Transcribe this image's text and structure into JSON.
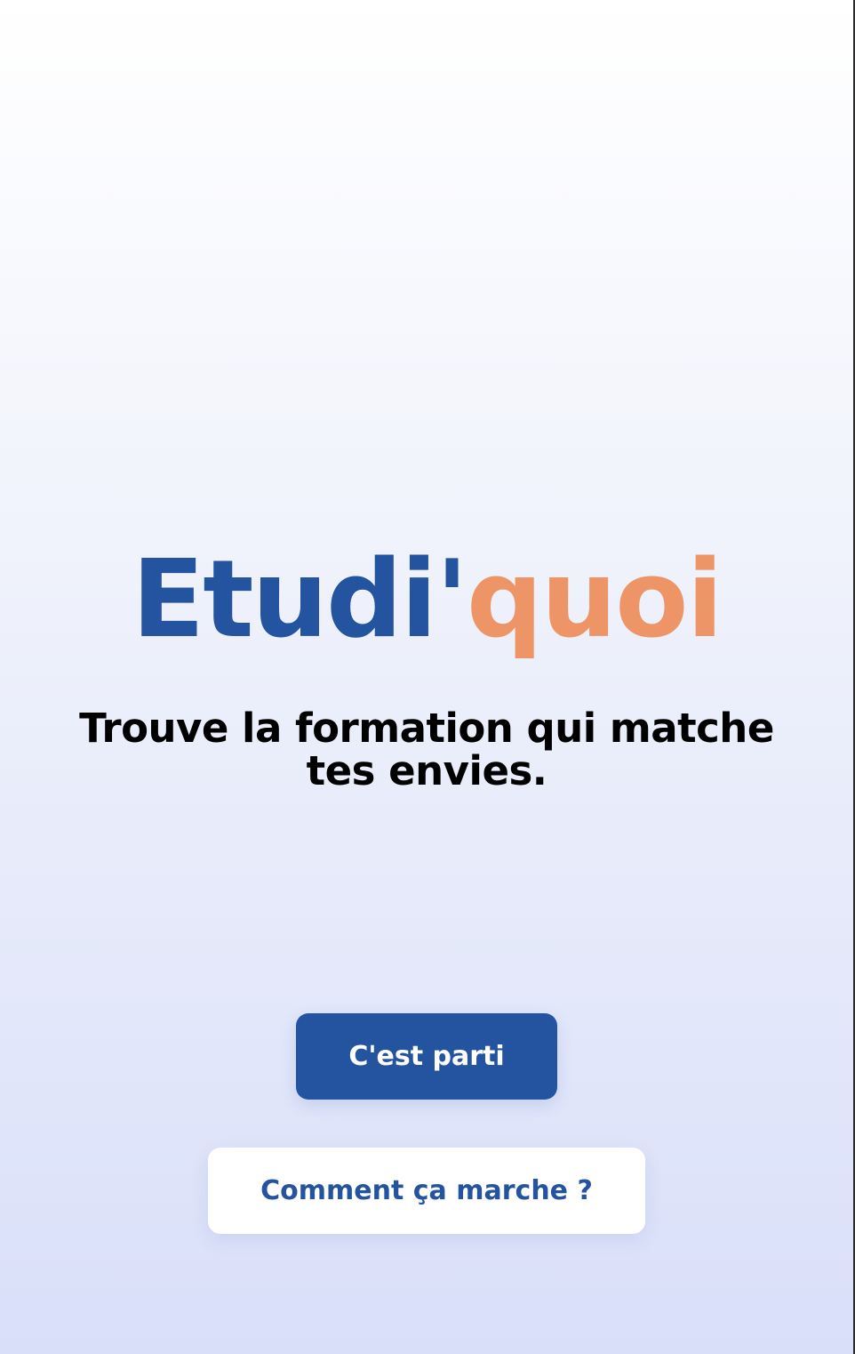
{
  "logo": {
    "part1": "Etudi'",
    "part2": "quoi",
    "colors": {
      "part1": "#24539f",
      "part2": "#ee9568"
    }
  },
  "tagline": "Trouve la formation qui matche tes envies.",
  "buttons": {
    "start_label": "C'est parti",
    "how_label": "Comment ça marche ?"
  },
  "colors": {
    "accent": "#24539f",
    "highlight": "#ee9568",
    "background_top": "#ffffff",
    "background_bottom": "#d9dff9"
  }
}
